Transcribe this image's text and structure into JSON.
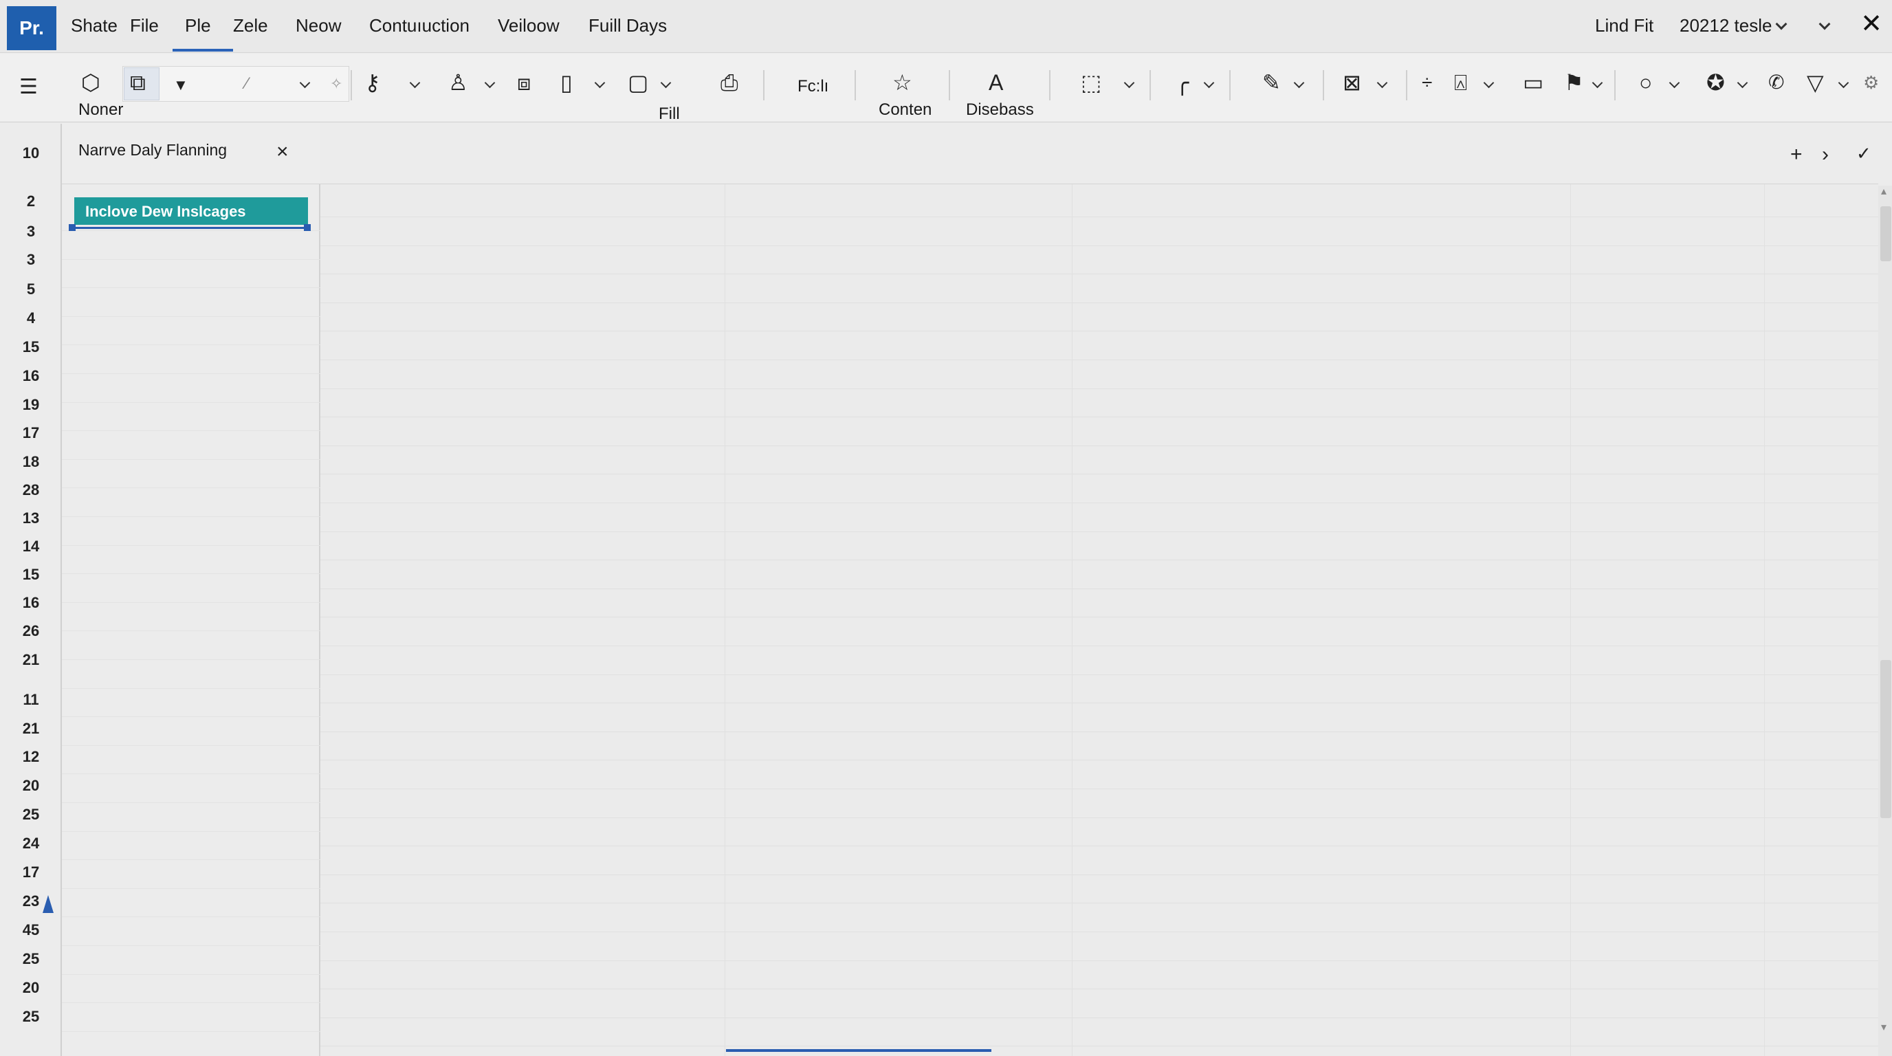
{
  "app": {
    "logo": "Pr."
  },
  "menu": {
    "items": [
      "Shate",
      "File",
      "Ple",
      "Zele",
      "Neow",
      "Contuıuction",
      "Veiloow",
      "Fuill Days"
    ],
    "active": "Ple",
    "right": {
      "lind_fit": "Lind Fit",
      "view_select": "20212 tesle"
    }
  },
  "toolbar": {
    "labels": {
      "noner": "Noner",
      "fill": "Fill",
      "fcl": "Fc:lı",
      "conten": "Conten",
      "disebass": "Disebass"
    },
    "icons": [
      "list-icon",
      "shape-icon",
      "layout-icon",
      "filter-icon",
      "pen-icon",
      "key-icon",
      "stamp-icon",
      "copy-icon",
      "page-icon",
      "frame-icon",
      "paint-icon",
      "star-icon",
      "text-a-icon",
      "resize-icon",
      "curve-icon",
      "brush-icon",
      "formula-icon",
      "split-icon",
      "lock-icon",
      "rectangle-icon",
      "flag-icon",
      "circle-icon",
      "badge-icon",
      "phone-icon",
      "funnel-icon",
      "settings-icon"
    ]
  },
  "rownumbers": {
    "header": "10",
    "rows": [
      "2",
      "3",
      "3",
      "5",
      "4",
      "15",
      "16",
      "19",
      "17",
      "18",
      "28",
      "13",
      "14",
      "15",
      "16",
      "26",
      "21",
      "11",
      "21",
      "12",
      "20",
      "25",
      "24",
      "17",
      "23",
      "45",
      "25",
      "20",
      "25"
    ]
  },
  "panel": {
    "title": "Narrve Daly Flanning",
    "selected_item": "Inclove Dew Inslcages"
  },
  "colors": {
    "accent": "#2a5db0",
    "selection": "#1f9b9b",
    "logo": "#1f5fae"
  }
}
